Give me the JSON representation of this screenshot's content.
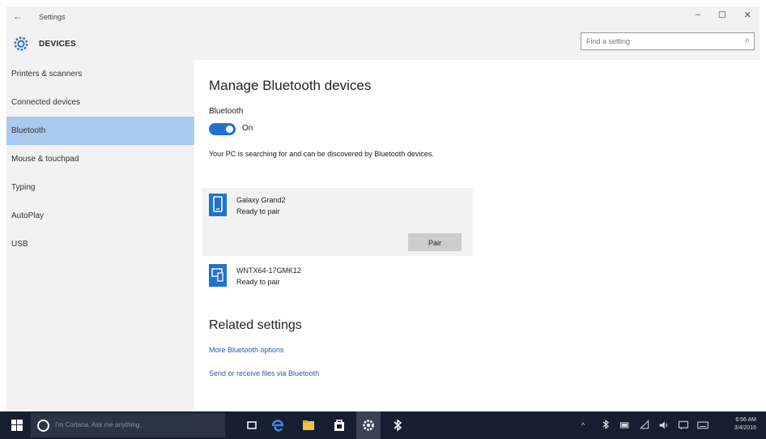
{
  "window": {
    "back_glyph": "←",
    "title": "Settings",
    "minimize": "–",
    "maximize": "☐",
    "close": "✕"
  },
  "header": {
    "section_title": "DEVICES",
    "search_placeholder": "Find a setting",
    "search_icon": "search-icon"
  },
  "sidebar": {
    "items": [
      {
        "label": "Printers & scanners"
      },
      {
        "label": "Connected devices"
      },
      {
        "label": "Bluetooth"
      },
      {
        "label": "Mouse & touchpad"
      },
      {
        "label": "Typing"
      },
      {
        "label": "AutoPlay"
      },
      {
        "label": "USB"
      }
    ],
    "active_index": 2
  },
  "main": {
    "title": "Manage Bluetooth devices",
    "bluetooth_label": "Bluetooth",
    "toggle_state": "On",
    "status_text": "Your PC is searching for and can be discovered by Bluetooth devices.",
    "devices": [
      {
        "name": "Galaxy Grand2",
        "status": "Ready to pair",
        "icon": "phone-icon"
      },
      {
        "name": "WNTX64-17GMK12",
        "status": "Ready to pair",
        "icon": "computer-phone-icon"
      }
    ],
    "pair_label": "Pair",
    "related_title": "Related settings",
    "links": [
      {
        "label": "More Bluetooth options"
      },
      {
        "label": "Send or receive files via Bluetooth"
      }
    ]
  },
  "taskbar": {
    "cortana_placeholder": "I'm Cortana. Ask me anything.",
    "clock_time": "6:56 AM",
    "clock_date": "3/4/2016",
    "tray_up": "^",
    "tray_icons": [
      "bluetooth-icon",
      "network-icon",
      "volume-icon",
      "message-icon",
      "keyboard-icon"
    ]
  },
  "colors": {
    "accent": "#1e73d0",
    "active_nav": "#a9c9ef",
    "link": "#1e5fb8",
    "taskbar": "#161e30"
  }
}
